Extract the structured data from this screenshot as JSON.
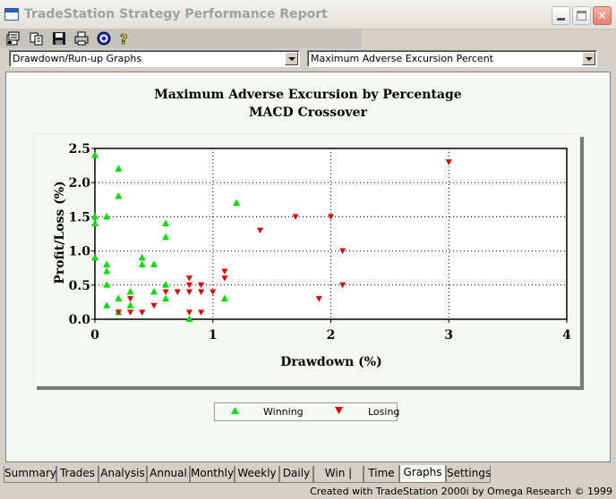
{
  "window": {
    "title": "TradeStation Strategy Performance Report"
  },
  "toolbar": {
    "icons": [
      "properties-icon",
      "copy-icon",
      "save-icon",
      "print-icon",
      "target-icon",
      "help-icon"
    ]
  },
  "selectors": {
    "report_type": "Drawdown/Run-up Graphs",
    "graph": "Maximum Adverse Excursion Percent"
  },
  "chart_data": {
    "type": "scatter",
    "title": "Maximum Adverse Excursion by Percentage",
    "subtitle": "MACD Crossover",
    "xlabel": "Drawdown (%)",
    "ylabel": "Profit/Loss (%)",
    "xlim": [
      0,
      4
    ],
    "ylim": [
      0,
      2.5
    ],
    "xticks": [
      "0",
      "1",
      "2",
      "3",
      "4"
    ],
    "yticks": [
      "0.0",
      "0.5",
      "1.0",
      "1.5",
      "2.0",
      "2.5"
    ],
    "grid": true,
    "legend_position": "bottom",
    "series": [
      {
        "name": "Winning",
        "marker": "triangle-up",
        "color": "#00e000",
        "points": [
          [
            0.0,
            2.4
          ],
          [
            0.0,
            1.5
          ],
          [
            0.0,
            1.4
          ],
          [
            0.0,
            0.9
          ],
          [
            0.1,
            1.5
          ],
          [
            0.1,
            0.8
          ],
          [
            0.1,
            0.7
          ],
          [
            0.1,
            0.5
          ],
          [
            0.1,
            0.2
          ],
          [
            0.2,
            2.2
          ],
          [
            0.2,
            1.8
          ],
          [
            0.2,
            0.3
          ],
          [
            0.2,
            0.1
          ],
          [
            0.3,
            0.4
          ],
          [
            0.3,
            0.2
          ],
          [
            0.4,
            0.9
          ],
          [
            0.4,
            0.8
          ],
          [
            0.5,
            0.8
          ],
          [
            0.5,
            0.4
          ],
          [
            0.6,
            1.4
          ],
          [
            0.6,
            1.2
          ],
          [
            0.6,
            0.5
          ],
          [
            0.6,
            0.3
          ],
          [
            0.8,
            0.0
          ],
          [
            1.1,
            0.3
          ],
          [
            1.2,
            1.7
          ]
        ]
      },
      {
        "name": "Losing",
        "marker": "triangle-down",
        "color": "#e00000",
        "points": [
          [
            0.2,
            0.1
          ],
          [
            0.3,
            0.3
          ],
          [
            0.3,
            0.1
          ],
          [
            0.4,
            0.1
          ],
          [
            0.5,
            0.2
          ],
          [
            0.6,
            0.4
          ],
          [
            0.7,
            0.4
          ],
          [
            0.8,
            0.6
          ],
          [
            0.8,
            0.5
          ],
          [
            0.8,
            0.4
          ],
          [
            0.8,
            0.1
          ],
          [
            0.9,
            0.5
          ],
          [
            0.9,
            0.4
          ],
          [
            0.9,
            0.1
          ],
          [
            1.0,
            0.4
          ],
          [
            1.1,
            0.7
          ],
          [
            1.1,
            0.6
          ],
          [
            1.4,
            1.3
          ],
          [
            1.7,
            1.5
          ],
          [
            1.9,
            0.3
          ],
          [
            2.0,
            1.5
          ],
          [
            2.1,
            1.0
          ],
          [
            2.1,
            0.5
          ],
          [
            3.0,
            2.3
          ]
        ]
      }
    ]
  },
  "legend": {
    "items": [
      {
        "label": "Winning",
        "color": "#00e000"
      },
      {
        "label": "Losing",
        "color": "#e00000"
      }
    ]
  },
  "tabs": [
    {
      "label": "Summary",
      "active": false
    },
    {
      "label": "Trades",
      "active": false
    },
    {
      "label": "Analysis",
      "active": false
    },
    {
      "label": "Annual",
      "active": false
    },
    {
      "label": "Monthly",
      "active": false
    },
    {
      "label": "Weekly",
      "active": false
    },
    {
      "label": "Daily",
      "active": false
    },
    {
      "label": "Win | Loss",
      "active": false
    },
    {
      "label": "Time",
      "active": false
    },
    {
      "label": "Graphs",
      "active": true
    },
    {
      "label": "Settings",
      "active": false
    }
  ],
  "status": {
    "text": "Created with TradeStation 2000i by Omega Research © 1999"
  }
}
